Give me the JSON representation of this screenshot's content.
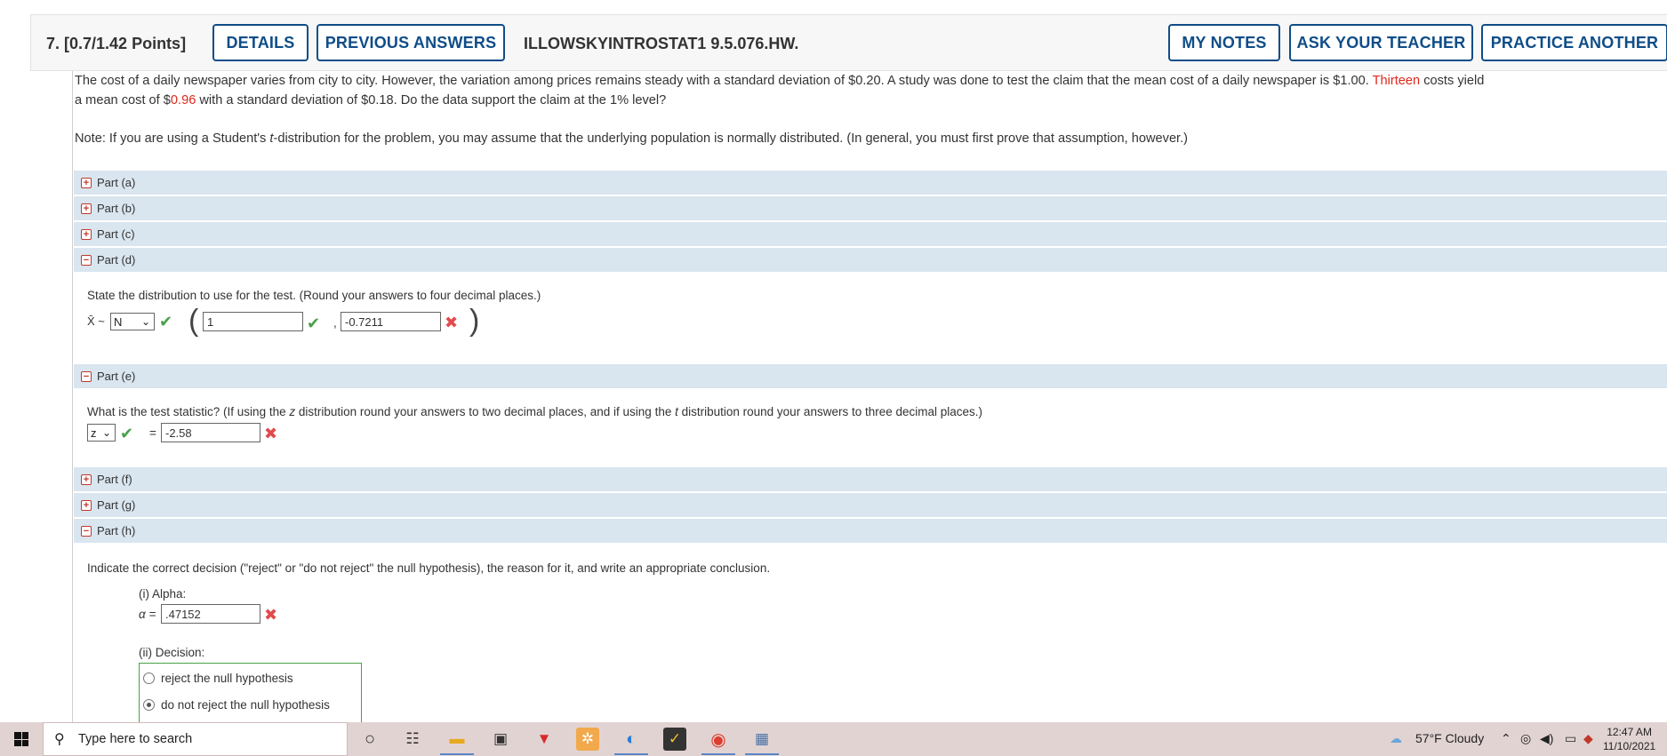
{
  "header": {
    "question_label": "7.  [0.7/1.42 Points]",
    "details_button": "DETAILS",
    "previous_answers_button": "PREVIOUS ANSWERS",
    "assignment_code": "ILLOWSKYINTROSTAT1 9.5.076.HW.",
    "my_notes_button": "MY NOTES",
    "ask_teacher_button": "ASK YOUR TEACHER",
    "practice_button": "PRACTICE ANOTHER"
  },
  "problem": {
    "line1_a": "The cost of a daily newspaper varies from city to city. However, the variation among prices remains steady with a standard deviation of $0.20. A study was done to test the claim that the mean cost of a daily newspaper is $1.00. ",
    "line1_red": "Thirteen",
    "line1_b": " costs yield",
    "line2_a": "a mean cost of $",
    "line2_red": "0.96",
    "line2_b": " with a standard deviation of $0.18. Do the data support the claim at the 1% level?",
    "note_a": "Note: If you are using a Student's ",
    "note_t": "t",
    "note_b": "-distribution for the problem, you may assume that the underlying population is normally distributed. (In general, you must first prove that assumption, however.)"
  },
  "parts": {
    "a": {
      "label": "Part (a)",
      "toggle": "+"
    },
    "b": {
      "label": "Part (b)",
      "toggle": "+"
    },
    "c": {
      "label": "Part (c)",
      "toggle": "+"
    },
    "d": {
      "label": "Part (d)",
      "toggle": "−",
      "prompt": "State the distribution to use for the test. (Round your answers to four decimal places.)",
      "xbar_tilde": "X̄ ~",
      "dist_select": "N",
      "mean_value": "1",
      "sd_value": "-0.7211",
      "comma": ","
    },
    "e": {
      "label": "Part (e)",
      "toggle": "−",
      "prompt_a": "What is the test statistic? (If using the ",
      "prompt_z": "z",
      "prompt_b": " distribution round your answers to two decimal places, and if using the ",
      "prompt_t": "t",
      "prompt_c": " distribution round your answers to three decimal places.)",
      "stat_select": "z",
      "equals": "=",
      "stat_value": "-2.58"
    },
    "f": {
      "label": "Part (f)",
      "toggle": "+"
    },
    "g": {
      "label": "Part (g)",
      "toggle": "+"
    },
    "h": {
      "label": "Part (h)",
      "toggle": "−",
      "prompt": "Indicate the correct decision (\"reject\" or \"do not reject\" the null hypothesis), the reason for it, and write an appropriate conclusion.",
      "alpha_heading": "(i) Alpha:",
      "alpha_label": "α =",
      "alpha_value": ".47152",
      "decision_heading": "(ii) Decision:",
      "option_reject": "reject the null hypothesis",
      "option_not_reject": "do not reject the null hypothesis"
    }
  },
  "taskbar": {
    "search_placeholder": "Type here to search",
    "weather": "57°F  Cloudy",
    "time": "12:47 AM",
    "date": "11/10/2021"
  },
  "icons": {
    "check_color": "#4aa04a",
    "cross_color": "#e24b4b",
    "button_color": "#0f4d87",
    "part_bar_color": "#d9e5ef"
  }
}
